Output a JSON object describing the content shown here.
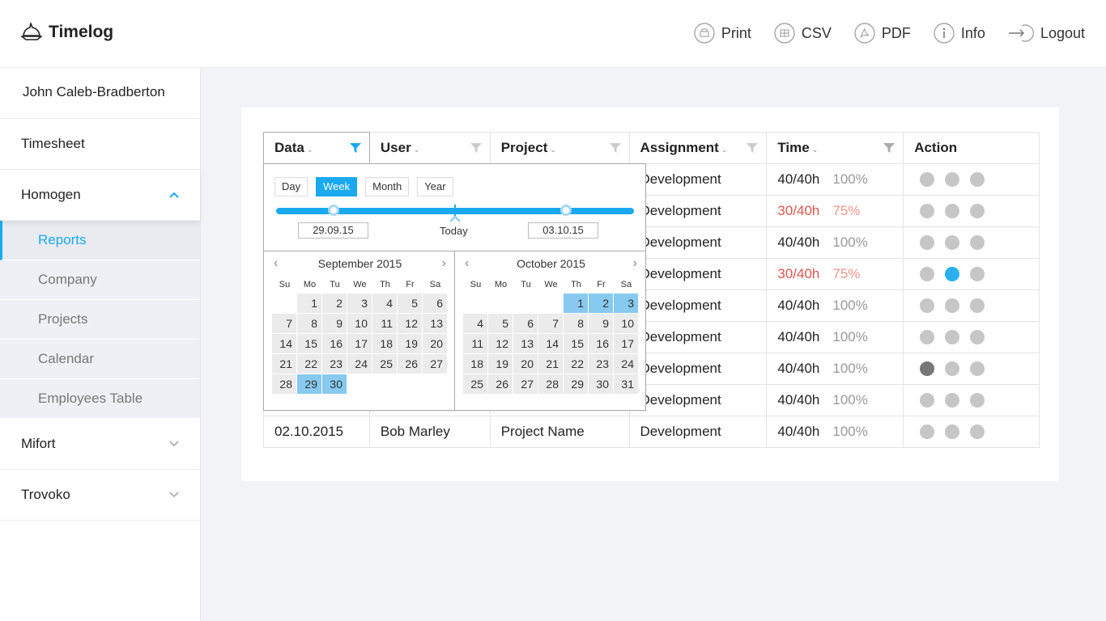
{
  "header": {
    "app_name": "Timelog",
    "tools": [
      {
        "label": "Print",
        "icon": "print-icon"
      },
      {
        "label": "CSV",
        "icon": "csv-icon"
      },
      {
        "label": "PDF",
        "icon": "pdf-icon"
      },
      {
        "label": "Info",
        "icon": "info-icon"
      },
      {
        "label": "Logout",
        "icon": "logout-icon"
      }
    ]
  },
  "sidebar": {
    "user": "John Caleb-Bradberton",
    "timesheet": "Timesheet",
    "homogen": "Homogen",
    "sub_items": [
      "Reports",
      "Company",
      "Projects",
      "Calendar",
      "Employees Table"
    ],
    "mifort": "Mifort",
    "trovoko": "Trovoko"
  },
  "table": {
    "headers": [
      "Data",
      "User",
      "Project",
      "Assignment",
      "Time",
      "Action"
    ],
    "rows": [
      {
        "date": "",
        "user": "",
        "project": "",
        "assignment": "Development",
        "time": "40/40h",
        "pct": "100%",
        "warn": false
      },
      {
        "date": "",
        "user": "",
        "project": "",
        "assignment": "Development",
        "time": "30/40h",
        "pct": "75%",
        "warn": true
      },
      {
        "date": "",
        "user": "",
        "project": "",
        "assignment": "Development",
        "time": "40/40h",
        "pct": "100%",
        "warn": false
      },
      {
        "date": "",
        "user": "",
        "project": "",
        "assignment": "Development",
        "time": "30/40h",
        "pct": "75%",
        "warn": true
      },
      {
        "date": "",
        "user": "",
        "project": "",
        "assignment": "Development",
        "time": "40/40h",
        "pct": "100%",
        "warn": false
      },
      {
        "date": "",
        "user": "",
        "project": "",
        "assignment": "Development",
        "time": "40/40h",
        "pct": "100%",
        "warn": false
      },
      {
        "date": "",
        "user": "",
        "project": "",
        "assignment": "Development",
        "time": "40/40h",
        "pct": "100%",
        "warn": false
      },
      {
        "date": "",
        "user": "",
        "project": "",
        "assignment": "Development",
        "time": "40/40h",
        "pct": "100%",
        "warn": false
      },
      {
        "date": "02.10.2015",
        "user": "Bob Marley",
        "project": "Project Name",
        "assignment": "Development",
        "time": "40/40h",
        "pct": "100%",
        "warn": false
      }
    ],
    "action_icons": [
      "chat-icon",
      "skype-icon",
      "hangouts-icon"
    ],
    "active_skype_row": 3,
    "active_chat_row": 6
  },
  "datepicker": {
    "ranges": [
      "Day",
      "Week",
      "Month",
      "Year"
    ],
    "selected_range": "Week",
    "slider": {
      "start_label": "29.09.15",
      "end_label": "03.10.15",
      "today_label": "Today",
      "start_value": 0.16,
      "today_value": 0.5,
      "end_value": 0.81
    },
    "weekdays": [
      "Su",
      "Mo",
      "Tu",
      "We",
      "Th",
      "Fr",
      "Sa"
    ],
    "months": [
      {
        "title": "September 2015",
        "offset": 1,
        "days": 30,
        "selected": [
          29,
          30
        ]
      },
      {
        "title": "October 2015",
        "offset": 4,
        "days": 31,
        "selected": [
          1,
          2,
          3
        ]
      }
    ]
  },
  "colors": {
    "accent": "#1aa9ef",
    "warn": "#e0544c",
    "selected_day": "#87c9ef"
  }
}
